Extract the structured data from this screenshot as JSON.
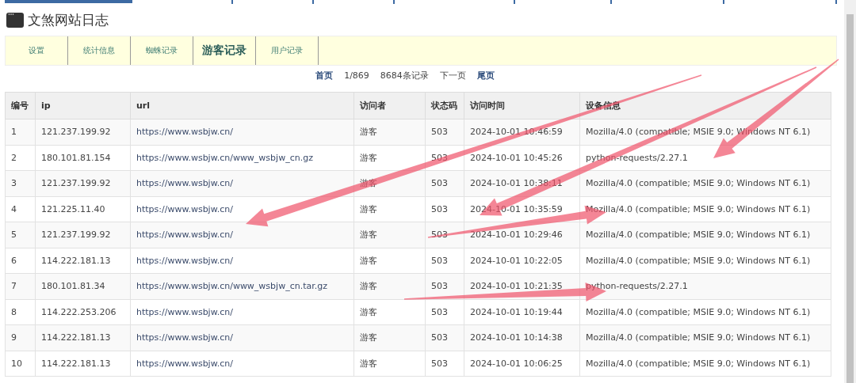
{
  "title": "文煞网站日志",
  "tabs": [
    {
      "label": "设置",
      "selected": false
    },
    {
      "label": "统计信息",
      "selected": false
    },
    {
      "label": "蜘蛛记录",
      "selected": false
    },
    {
      "label": "游客记录",
      "selected": true
    },
    {
      "label": "用户记录",
      "selected": false
    }
  ],
  "pagination": [
    {
      "text": "首页",
      "kind": "link"
    },
    {
      "text": "1/869",
      "kind": "text"
    },
    {
      "text": "8684条记录",
      "kind": "text"
    },
    {
      "text": "下一页",
      "kind": "text"
    },
    {
      "text": "尾页",
      "kind": "link"
    }
  ],
  "table": {
    "columns": [
      "编号",
      "ip",
      "url",
      "访问者",
      "状态码",
      "访问时间",
      "设备信息"
    ],
    "rows": [
      [
        "1",
        "121.237.199.92",
        "https://www.wsbjw.cn/",
        "游客",
        "503",
        "2024-10-01 10:46:59",
        "Mozilla/4.0 (compatible; MSIE 9.0; Windows NT 6.1)"
      ],
      [
        "2",
        "180.101.81.154",
        "https://www.wsbjw.cn/www_wsbjw_cn.gz",
        "游客",
        "503",
        "2024-10-01 10:45:26",
        "python-requests/2.27.1"
      ],
      [
        "3",
        "121.237.199.92",
        "https://www.wsbjw.cn/",
        "游客",
        "503",
        "2024-10-01 10:38:11",
        "Mozilla/4.0 (compatible; MSIE 9.0; Windows NT 6.1)"
      ],
      [
        "4",
        "121.225.11.40",
        "https://www.wsbjw.cn/",
        "游客",
        "503",
        "2024-10-01 10:35:59",
        "Mozilla/4.0 (compatible; MSIE 9.0; Windows NT 6.1)"
      ],
      [
        "5",
        "121.237.199.92",
        "https://www.wsbjw.cn/",
        "游客",
        "503",
        "2024-10-01 10:29:46",
        "Mozilla/4.0 (compatible; MSIE 9.0; Windows NT 6.1)"
      ],
      [
        "6",
        "114.222.181.13",
        "https://www.wsbjw.cn/",
        "游客",
        "503",
        "2024-10-01 10:22:05",
        "Mozilla/4.0 (compatible; MSIE 9.0; Windows NT 6.1)"
      ],
      [
        "7",
        "180.101.81.34",
        "https://www.wsbjw.cn/www_wsbjw_cn.tar.gz",
        "游客",
        "503",
        "2024-10-01 10:21:35",
        "python-requests/2.27.1"
      ],
      [
        "8",
        "114.222.253.206",
        "https://www.wsbjw.cn/",
        "游客",
        "503",
        "2024-10-01 10:19:44",
        "Mozilla/4.0 (compatible; MSIE 9.0; Windows NT 6.1)"
      ],
      [
        "9",
        "114.222.181.13",
        "https://www.wsbjw.cn/",
        "游客",
        "503",
        "2024-10-01 10:14:38",
        "Mozilla/4.0 (compatible; MSIE 9.0; Windows NT 6.1)"
      ],
      [
        "10",
        "114.222.181.13",
        "https://www.wsbjw.cn/",
        "游客",
        "503",
        "2024-10-01 10:06:25",
        "Mozilla/4.0 (compatible; MSIE 9.0; Windows NT 6.1)"
      ]
    ]
  }
}
